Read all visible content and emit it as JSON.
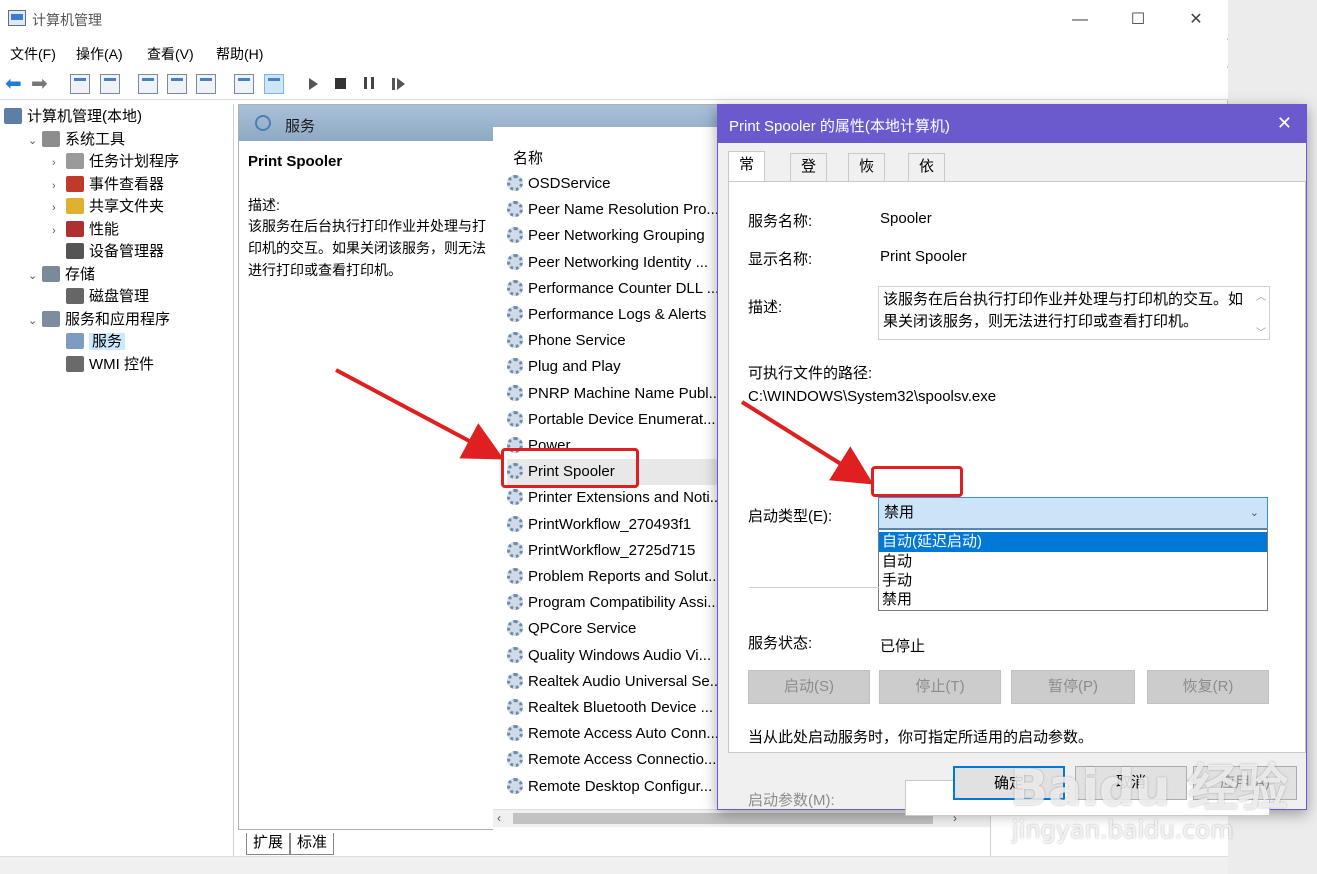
{
  "window": {
    "title": "计算机管理",
    "controls": [
      "—",
      "☐",
      "✕"
    ]
  },
  "menu": [
    "文件(F)",
    "操作(A)",
    "查看(V)",
    "帮助(H)"
  ],
  "tree": [
    {
      "label": "计算机管理(本地)",
      "level": 0,
      "chevron": "",
      "icon": "computer-icon",
      "color": "#5b7fa6"
    },
    {
      "label": "系统工具",
      "level": 1,
      "chevron": "⌄",
      "icon": "tools-icon",
      "color": "#8d8d8d"
    },
    {
      "label": "任务计划程序",
      "level": 2,
      "chevron": "›",
      "icon": "clock-icon",
      "color": "#9a9a9a"
    },
    {
      "label": "事件查看器",
      "level": 2,
      "chevron": "›",
      "icon": "event-viewer-icon",
      "color": "#c0392b"
    },
    {
      "label": "共享文件夹",
      "level": 2,
      "chevron": "›",
      "icon": "shared-folder-icon",
      "color": "#e0b030"
    },
    {
      "label": "性能",
      "level": 2,
      "chevron": "›",
      "icon": "performance-icon",
      "color": "#b03030"
    },
    {
      "label": "设备管理器",
      "level": 2,
      "chevron": "",
      "icon": "device-manager-icon",
      "color": "#555555"
    },
    {
      "label": "存储",
      "level": 1,
      "chevron": "⌄",
      "icon": "storage-icon",
      "color": "#7a8a9a"
    },
    {
      "label": "磁盘管理",
      "level": 2,
      "chevron": "",
      "icon": "disk-icon",
      "color": "#666666"
    },
    {
      "label": "服务和应用程序",
      "level": 1,
      "chevron": "⌄",
      "icon": "services-apps-icon",
      "color": "#7d8da0"
    },
    {
      "label": "服务",
      "level": 2,
      "chevron": "",
      "icon": "services-icon",
      "color": "#7d9cbf",
      "selected": true
    },
    {
      "label": "WMI 控件",
      "level": 2,
      "chevron": "",
      "icon": "wmi-icon",
      "color": "#6a6a6a"
    }
  ],
  "services_panel": {
    "header": "服务",
    "selected_name": "Print Spooler",
    "desc_label": "描述:",
    "desc_text": "该服务在后台执行打印作业并处理与打印机的交互。如果关闭该服务，则无法进行打印或查看打印机。",
    "column_name": "名称",
    "rows": [
      "OSDService",
      "Peer Name Resolution Pro...",
      "Peer Networking Grouping",
      "Peer Networking Identity ...",
      "Performance Counter DLL ...",
      "Performance Logs & Alerts",
      "Phone Service",
      "Plug and Play",
      "PNRP Machine Name Publ...",
      "Portable Device Enumerat...",
      "Power",
      "Print Spooler",
      "Printer Extensions and Noti...",
      "PrintWorkflow_270493f1",
      "PrintWorkflow_2725d715",
      "Problem Reports and Solut...",
      "Program Compatibility Assi...",
      "QPCore Service",
      "Quality Windows Audio Vi...",
      "Realtek Audio Universal Se...",
      "Realtek Bluetooth Device ...",
      "Remote Access Auto Conn...",
      "Remote Access Connectio...",
      "Remote Desktop Configur..."
    ],
    "selected_index": 11
  },
  "bottom_tabs": [
    "扩展",
    "标准"
  ],
  "dialog": {
    "title": "Print Spooler 的属性(本地计算机)",
    "close": "✕",
    "tabs": [
      "常规",
      "登录",
      "恢复",
      "依存关系"
    ],
    "service_name_label": "服务名称:",
    "service_name": "Spooler",
    "display_name_label": "显示名称:",
    "display_name": "Print Spooler",
    "desc_label": "描述:",
    "desc": "该服务在后台执行打印作业并处理与打印机的交互。如果关闭该服务，则无法进行打印或查看打印机。",
    "path_label": "可执行文件的路径:",
    "path": "C:\\WINDOWS\\System32\\spoolsv.exe",
    "startup_label": "启动类型(E):",
    "startup_value": "禁用",
    "startup_options": [
      "自动(延迟启动)",
      "自动",
      "手动",
      "禁用"
    ],
    "highlighted_option": 0,
    "status_label": "服务状态:",
    "status": "已停止",
    "buttons": [
      "启动(S)",
      "停止(T)",
      "暂停(P)",
      "恢复(R)"
    ],
    "hint": "当从此处启动服务时，你可指定所适用的启动参数。",
    "param_label": "启动参数(M):",
    "ok": "确定",
    "cancel": "取消",
    "apply": "应用(A)"
  },
  "watermark": {
    "brand": "Baidu 经验",
    "url": "jingyan.baidu.com"
  },
  "colors": {
    "accent": "#6a5acd",
    "selection": "#0078d7",
    "annotation_red": "#e02020"
  }
}
